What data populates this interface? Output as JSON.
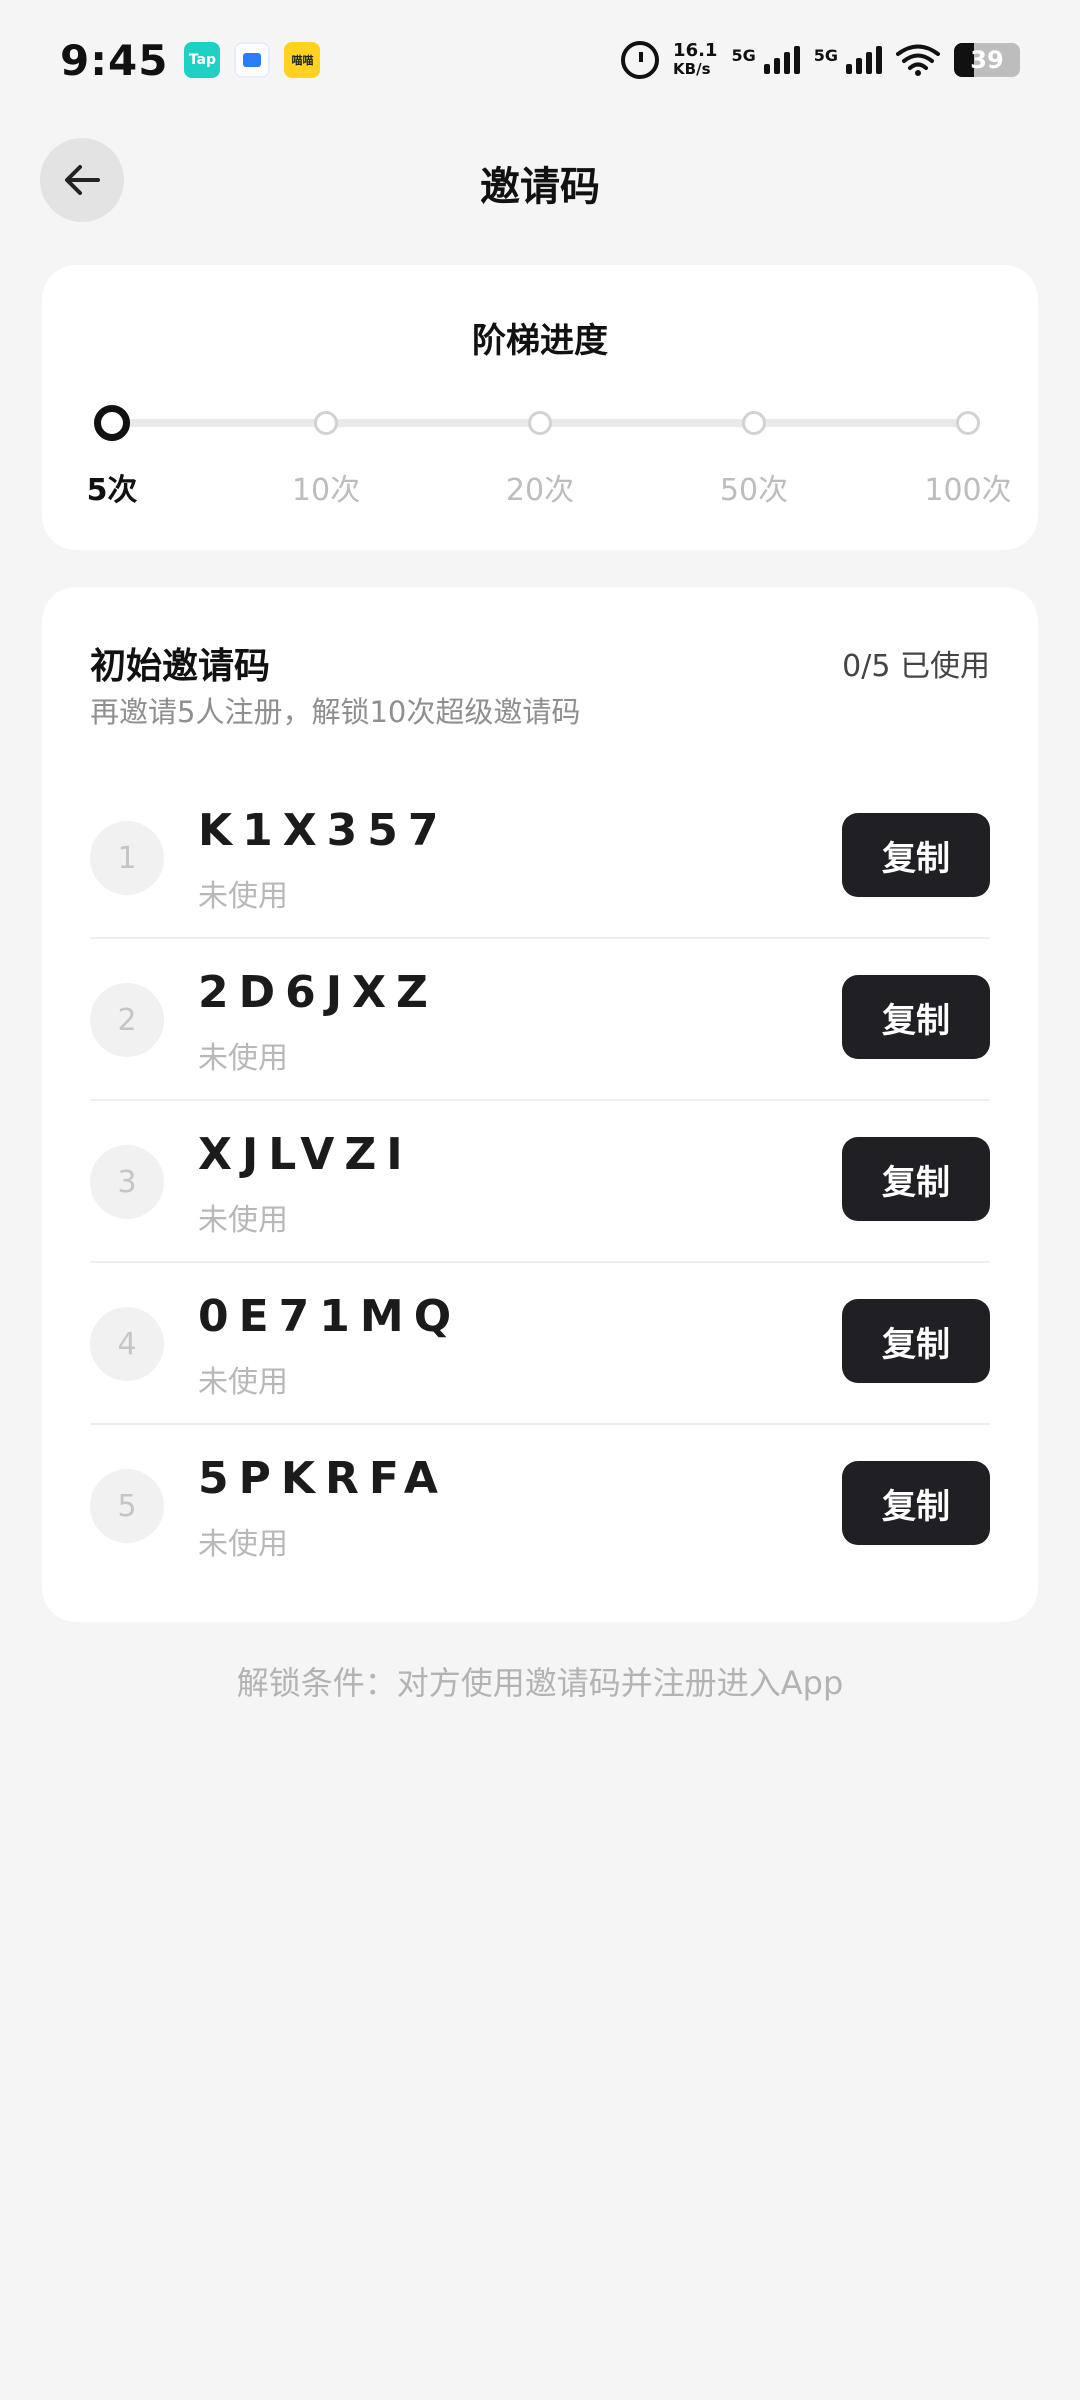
{
  "status_bar": {
    "time": "9:45",
    "apps": [
      {
        "name": "taptap-icon",
        "label": "Tap"
      },
      {
        "name": "blue-app-icon",
        "label": ""
      },
      {
        "name": "yellow-app-icon",
        "label": "喵喵"
      }
    ],
    "speed_value": "16.1",
    "speed_unit": "KB/s",
    "signal1": "5G",
    "signal2": "5G",
    "battery": "39"
  },
  "header": {
    "title": "邀请码"
  },
  "progress": {
    "title": "阶梯进度",
    "steps": [
      {
        "label": "5次",
        "active": true
      },
      {
        "label": "10次",
        "active": false
      },
      {
        "label": "20次",
        "active": false
      },
      {
        "label": "50次",
        "active": false
      },
      {
        "label": "100次",
        "active": false
      }
    ]
  },
  "codes_section": {
    "title": "初始邀请码",
    "used_text": "0/5 已使用",
    "subtitle": "再邀请5人注册，解锁10次超级邀请码",
    "copy_label": "复制",
    "items": [
      {
        "index": "1",
        "code": "K1X357",
        "status": "未使用"
      },
      {
        "index": "2",
        "code": "2D6JXZ",
        "status": "未使用"
      },
      {
        "index": "3",
        "code": "XJLVZI",
        "status": "未使用"
      },
      {
        "index": "4",
        "code": "0E71MQ",
        "status": "未使用"
      },
      {
        "index": "5",
        "code": "5PKRFA",
        "status": "未使用"
      }
    ]
  },
  "footer": {
    "note": "解锁条件：对方使用邀请码并注册进入App"
  }
}
